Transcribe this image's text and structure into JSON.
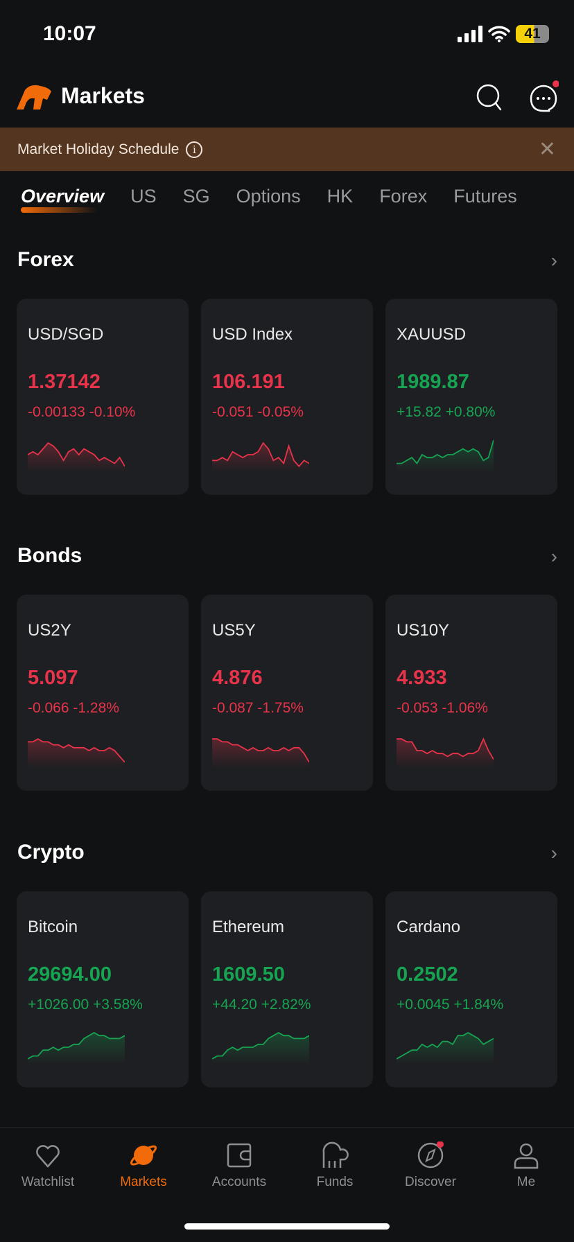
{
  "status_bar": {
    "time": "10:07",
    "battery": "41"
  },
  "header": {
    "title": "Markets",
    "icons": [
      "search-icon",
      "chat-icon"
    ]
  },
  "banner": {
    "text": "Market Holiday Schedule",
    "icon": "info-icon"
  },
  "tabs": [
    {
      "label": "Overview",
      "active": true
    },
    {
      "label": "US"
    },
    {
      "label": "SG"
    },
    {
      "label": "Options"
    },
    {
      "label": "HK"
    },
    {
      "label": "Forex"
    },
    {
      "label": "Futures"
    }
  ],
  "colors": {
    "down": "#e8334a",
    "up": "#16a452",
    "accent": "#f26b0a",
    "banner": "#533520",
    "card": "#1e1f22"
  },
  "sections": [
    {
      "title": "Forex",
      "cards": [
        {
          "name": "USD/SGD",
          "price": "1.37142",
          "change": "-0.00133 -0.10%",
          "dir": "down",
          "trend": [
            5,
            6,
            5,
            7,
            9,
            8,
            6,
            3,
            6,
            7,
            5,
            7,
            6,
            5,
            3,
            4,
            3,
            2,
            4,
            1
          ]
        },
        {
          "name": "USD Index",
          "price": "106.191",
          "change": "-0.051 -0.05%",
          "dir": "down",
          "trend": [
            3,
            3,
            4,
            3,
            6,
            5,
            4,
            5,
            5,
            6,
            9,
            7,
            3,
            4,
            2,
            8,
            3,
            1,
            3,
            2
          ]
        },
        {
          "name": "XAUUSD",
          "price": "1989.87",
          "change": "+15.82 +0.80%",
          "dir": "up",
          "trend": [
            2,
            2,
            3,
            4,
            2,
            5,
            4,
            4,
            5,
            4,
            5,
            5,
            6,
            7,
            6,
            7,
            6,
            3,
            4,
            10
          ]
        }
      ]
    },
    {
      "title": "Bonds",
      "cards": [
        {
          "name": "US2Y",
          "price": "5.097",
          "change": "-0.066 -1.28%",
          "dir": "down",
          "trend": [
            8,
            8,
            9,
            8,
            8,
            7,
            7,
            6,
            7,
            6,
            6,
            6,
            5,
            6,
            5,
            5,
            6,
            5,
            3,
            1
          ]
        },
        {
          "name": "US5Y",
          "price": "4.876",
          "change": "-0.087 -1.75%",
          "dir": "down",
          "trend": [
            9,
            9,
            8,
            8,
            7,
            7,
            6,
            5,
            6,
            5,
            5,
            6,
            5,
            5,
            6,
            5,
            6,
            6,
            4,
            1
          ]
        },
        {
          "name": "US10Y",
          "price": "4.933",
          "change": "-0.053 -1.06%",
          "dir": "down",
          "trend": [
            9,
            9,
            8,
            8,
            5,
            5,
            4,
            5,
            4,
            4,
            3,
            4,
            4,
            3,
            4,
            4,
            5,
            9,
            5,
            2
          ]
        }
      ]
    },
    {
      "title": "Crypto",
      "cards": [
        {
          "name": "Bitcoin",
          "price": "29694.00",
          "change": "+1026.00 +3.58%",
          "dir": "up",
          "trend": [
            1,
            2,
            2,
            4,
            4,
            5,
            4,
            5,
            5,
            6,
            6,
            8,
            9,
            10,
            9,
            9,
            8,
            8,
            8,
            9
          ]
        },
        {
          "name": "Ethereum",
          "price": "1609.50",
          "change": "+44.20 +2.82%",
          "dir": "up",
          "trend": [
            1,
            2,
            2,
            4,
            5,
            4,
            5,
            5,
            5,
            6,
            6,
            8,
            9,
            10,
            9,
            9,
            8,
            8,
            8,
            9
          ]
        },
        {
          "name": "Cardano",
          "price": "0.2502",
          "change": "+0.0045 +1.84%",
          "dir": "up",
          "trend": [
            1,
            2,
            3,
            4,
            4,
            6,
            5,
            6,
            5,
            7,
            7,
            6,
            9,
            9,
            10,
            9,
            8,
            6,
            7,
            8
          ]
        }
      ]
    }
  ],
  "tabbar": [
    {
      "label": "Watchlist",
      "icon": "heart-icon"
    },
    {
      "label": "Markets",
      "icon": "planet-icon",
      "active": true
    },
    {
      "label": "Accounts",
      "icon": "wallet-icon"
    },
    {
      "label": "Funds",
      "icon": "elephant-icon"
    },
    {
      "label": "Discover",
      "icon": "compass-icon",
      "badge": true
    },
    {
      "label": "Me",
      "icon": "person-icon"
    }
  ]
}
